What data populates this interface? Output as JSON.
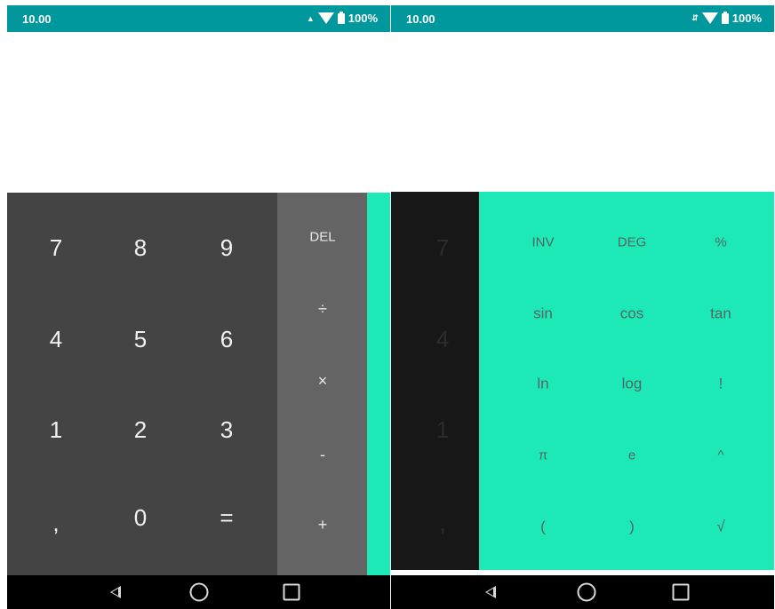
{
  "left": {
    "status": {
      "time": "10.00",
      "battery": "100%"
    },
    "numpad": [
      "7",
      "8",
      "9",
      "4",
      "5",
      "6",
      "1",
      "2",
      "3",
      ",",
      "0",
      "="
    ],
    "ops": [
      "DEL",
      "÷",
      "×",
      "-",
      "+"
    ]
  },
  "right": {
    "status": {
      "time": "10.00",
      "battery": "100%"
    },
    "numpad": [
      "7",
      "4",
      "1",
      ","
    ],
    "advanced": [
      "INV",
      "DEG",
      "%",
      "sin",
      "cos",
      "tan",
      "ln",
      "log",
      "!",
      "π",
      "e",
      "^",
      "(",
      ")",
      "√"
    ]
  },
  "colors": {
    "status_bar": "#00979d",
    "numpad_bg": "#444444",
    "ops_bg": "#646464",
    "advanced_bg": "#1de9b6",
    "dim_numpad_bg": "#171717"
  },
  "icons": [
    "back-icon",
    "home-icon",
    "recents-icon",
    "wifi-icon",
    "battery-icon",
    "data-arrows-icon"
  ]
}
